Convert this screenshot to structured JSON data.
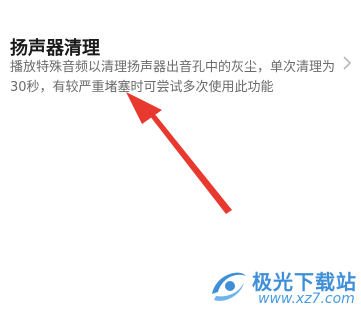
{
  "speaker_clean": {
    "title": "扬声器清理",
    "description": "播放特殊音频以清理扬声器出音孔中的灰尘，单次清理为30秒，有较严重堵塞时可尝试多次使用此功能",
    "chevron_icon": "chevron-right-icon"
  },
  "overlay": {
    "arrow_color": "#e8392f",
    "arrow_icon": "red-arrow-annotation"
  },
  "watermark": {
    "name": "极光下载站",
    "url": "www.xz7.com",
    "color": "#3f8fd8"
  }
}
